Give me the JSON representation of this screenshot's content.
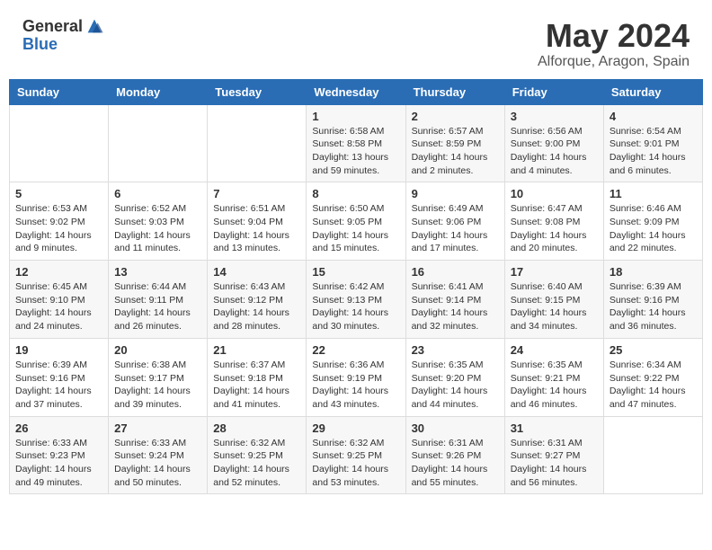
{
  "header": {
    "logo_general": "General",
    "logo_blue": "Blue",
    "month_title": "May 2024",
    "location": "Alforque, Aragon, Spain"
  },
  "weekdays": [
    "Sunday",
    "Monday",
    "Tuesday",
    "Wednesday",
    "Thursday",
    "Friday",
    "Saturday"
  ],
  "weeks": [
    [
      {
        "day": "",
        "text": ""
      },
      {
        "day": "",
        "text": ""
      },
      {
        "day": "",
        "text": ""
      },
      {
        "day": "1",
        "text": "Sunrise: 6:58 AM\nSunset: 8:58 PM\nDaylight: 13 hours and 59 minutes."
      },
      {
        "day": "2",
        "text": "Sunrise: 6:57 AM\nSunset: 8:59 PM\nDaylight: 14 hours and 2 minutes."
      },
      {
        "day": "3",
        "text": "Sunrise: 6:56 AM\nSunset: 9:00 PM\nDaylight: 14 hours and 4 minutes."
      },
      {
        "day": "4",
        "text": "Sunrise: 6:54 AM\nSunset: 9:01 PM\nDaylight: 14 hours and 6 minutes."
      }
    ],
    [
      {
        "day": "5",
        "text": "Sunrise: 6:53 AM\nSunset: 9:02 PM\nDaylight: 14 hours and 9 minutes."
      },
      {
        "day": "6",
        "text": "Sunrise: 6:52 AM\nSunset: 9:03 PM\nDaylight: 14 hours and 11 minutes."
      },
      {
        "day": "7",
        "text": "Sunrise: 6:51 AM\nSunset: 9:04 PM\nDaylight: 14 hours and 13 minutes."
      },
      {
        "day": "8",
        "text": "Sunrise: 6:50 AM\nSunset: 9:05 PM\nDaylight: 14 hours and 15 minutes."
      },
      {
        "day": "9",
        "text": "Sunrise: 6:49 AM\nSunset: 9:06 PM\nDaylight: 14 hours and 17 minutes."
      },
      {
        "day": "10",
        "text": "Sunrise: 6:47 AM\nSunset: 9:08 PM\nDaylight: 14 hours and 20 minutes."
      },
      {
        "day": "11",
        "text": "Sunrise: 6:46 AM\nSunset: 9:09 PM\nDaylight: 14 hours and 22 minutes."
      }
    ],
    [
      {
        "day": "12",
        "text": "Sunrise: 6:45 AM\nSunset: 9:10 PM\nDaylight: 14 hours and 24 minutes."
      },
      {
        "day": "13",
        "text": "Sunrise: 6:44 AM\nSunset: 9:11 PM\nDaylight: 14 hours and 26 minutes."
      },
      {
        "day": "14",
        "text": "Sunrise: 6:43 AM\nSunset: 9:12 PM\nDaylight: 14 hours and 28 minutes."
      },
      {
        "day": "15",
        "text": "Sunrise: 6:42 AM\nSunset: 9:13 PM\nDaylight: 14 hours and 30 minutes."
      },
      {
        "day": "16",
        "text": "Sunrise: 6:41 AM\nSunset: 9:14 PM\nDaylight: 14 hours and 32 minutes."
      },
      {
        "day": "17",
        "text": "Sunrise: 6:40 AM\nSunset: 9:15 PM\nDaylight: 14 hours and 34 minutes."
      },
      {
        "day": "18",
        "text": "Sunrise: 6:39 AM\nSunset: 9:16 PM\nDaylight: 14 hours and 36 minutes."
      }
    ],
    [
      {
        "day": "19",
        "text": "Sunrise: 6:39 AM\nSunset: 9:16 PM\nDaylight: 14 hours and 37 minutes."
      },
      {
        "day": "20",
        "text": "Sunrise: 6:38 AM\nSunset: 9:17 PM\nDaylight: 14 hours and 39 minutes."
      },
      {
        "day": "21",
        "text": "Sunrise: 6:37 AM\nSunset: 9:18 PM\nDaylight: 14 hours and 41 minutes."
      },
      {
        "day": "22",
        "text": "Sunrise: 6:36 AM\nSunset: 9:19 PM\nDaylight: 14 hours and 43 minutes."
      },
      {
        "day": "23",
        "text": "Sunrise: 6:35 AM\nSunset: 9:20 PM\nDaylight: 14 hours and 44 minutes."
      },
      {
        "day": "24",
        "text": "Sunrise: 6:35 AM\nSunset: 9:21 PM\nDaylight: 14 hours and 46 minutes."
      },
      {
        "day": "25",
        "text": "Sunrise: 6:34 AM\nSunset: 9:22 PM\nDaylight: 14 hours and 47 minutes."
      }
    ],
    [
      {
        "day": "26",
        "text": "Sunrise: 6:33 AM\nSunset: 9:23 PM\nDaylight: 14 hours and 49 minutes."
      },
      {
        "day": "27",
        "text": "Sunrise: 6:33 AM\nSunset: 9:24 PM\nDaylight: 14 hours and 50 minutes."
      },
      {
        "day": "28",
        "text": "Sunrise: 6:32 AM\nSunset: 9:25 PM\nDaylight: 14 hours and 52 minutes."
      },
      {
        "day": "29",
        "text": "Sunrise: 6:32 AM\nSunset: 9:25 PM\nDaylight: 14 hours and 53 minutes."
      },
      {
        "day": "30",
        "text": "Sunrise: 6:31 AM\nSunset: 9:26 PM\nDaylight: 14 hours and 55 minutes."
      },
      {
        "day": "31",
        "text": "Sunrise: 6:31 AM\nSunset: 9:27 PM\nDaylight: 14 hours and 56 minutes."
      },
      {
        "day": "",
        "text": ""
      }
    ]
  ]
}
